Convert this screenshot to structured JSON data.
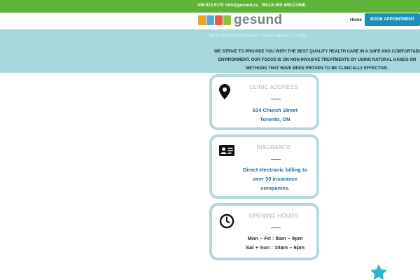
{
  "topbar": {
    "phone": "416-913-5170",
    "email": "info@gesund.ca",
    "notice": "WALK-INS WELCOME"
  },
  "header": {
    "logo_text": "gesund",
    "logo_tile_colors": [
      "#f0a22a",
      "#56a8d6",
      "#e2603c",
      "#8cc63e"
    ],
    "nav_home": "Home",
    "book_button": "BOOK APPOINTMENT"
  },
  "band": {
    "title": "MULTIDISCIPLINARY WELLNESS CLINIC",
    "lines": [
      "WE STRIVE TO PROVIDE YOU WITH THE BEST QUALITY HEALTH CARE IN A SAFE AND COMFORTABLE",
      "ENVIRONMENT. OUR FOCUS IS ON NON-INVASIVE TREATMENTS BY USING NATURAL HANDS-ON",
      "METHODS THAT HAVE BEEN PROVEN TO BE CLINICALLY EFFECTIVE."
    ]
  },
  "cards": {
    "address": {
      "icon": "map-pin-icon",
      "title": "CLINIC ADDRESS",
      "lines": [
        "614 Church Street",
        "Toronto, ON"
      ]
    },
    "insurance": {
      "icon": "id-card-icon",
      "title": "INSURANCE",
      "lines": [
        "Direct electronic billing to",
        "over 30 insurance",
        "companies."
      ]
    },
    "hours": {
      "icon": "clock-icon",
      "title": "OPENING HOURS",
      "lines": [
        "Mon – Fri : 8am – 9pm",
        "Sat + Sun : 10am – 6pm"
      ]
    }
  },
  "colors": {
    "topbar": "#5fb338",
    "band": "#a6d7dd",
    "accent_blue": "#1b8fb7",
    "card_border": "#b6d8dd",
    "star": "#2bb8d3"
  }
}
